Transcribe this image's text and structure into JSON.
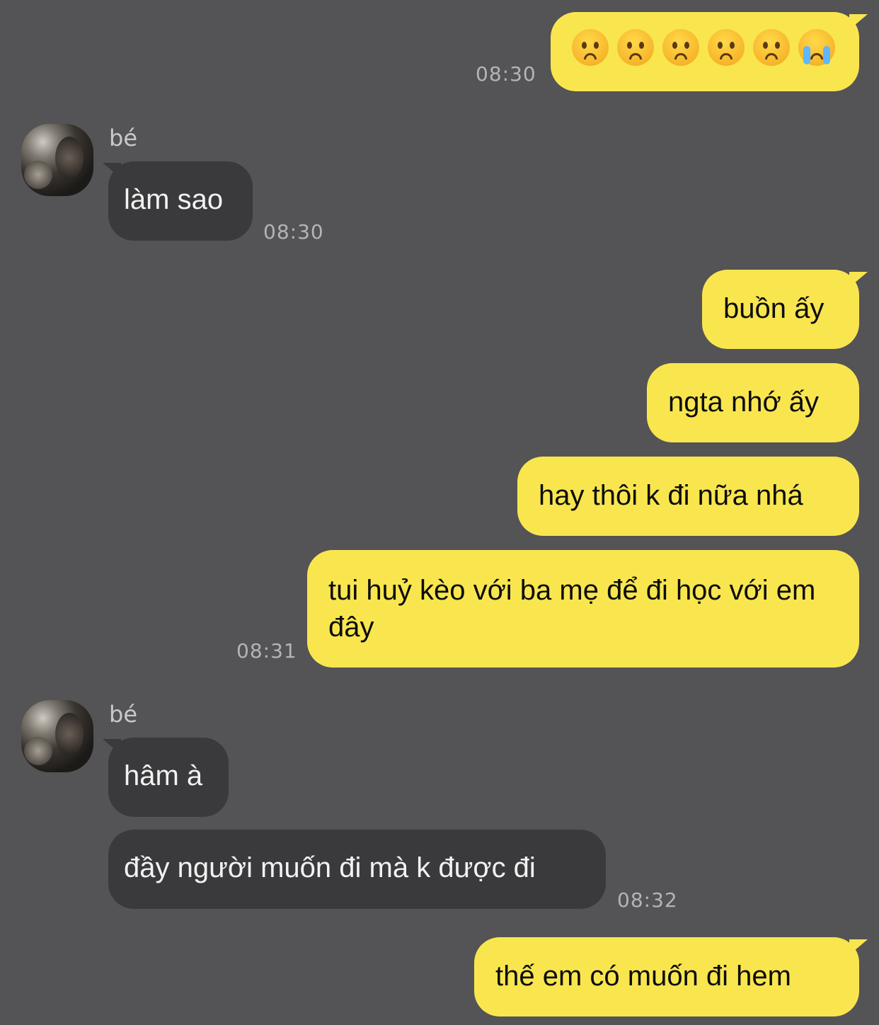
{
  "conversation": {
    "messages": [
      {
        "id": "m1",
        "direction": "outgoing",
        "text": "😟😩😣😟😔😭",
        "time": "08:30"
      },
      {
        "id": "m2",
        "direction": "incoming",
        "sender": "bé",
        "text": "làm sao",
        "time": "08:30"
      },
      {
        "id": "m3",
        "direction": "outgoing",
        "text": "buồn ấy"
      },
      {
        "id": "m4",
        "direction": "outgoing",
        "text": "ngta nhớ ấy"
      },
      {
        "id": "m5",
        "direction": "outgoing",
        "text": "hay thôi k đi nữa nhá"
      },
      {
        "id": "m6",
        "direction": "outgoing",
        "text": "tui huỷ kèo với ba mẹ để đi học với em đây",
        "time": "08:31"
      },
      {
        "id": "m7",
        "direction": "incoming",
        "sender": "bé",
        "text": "hâm à"
      },
      {
        "id": "m8",
        "direction": "incoming",
        "text": "đầy người muốn đi mà k được đi",
        "time": "08:32"
      },
      {
        "id": "m9",
        "direction": "outgoing",
        "text": "thế em có muốn đi hem"
      }
    ],
    "emoji_names": [
      "anxious-face-icon",
      "weary-face-icon",
      "persevering-face-icon",
      "worried-face-icon",
      "pensive-face-icon",
      "loudly-crying-face-icon"
    ]
  },
  "colors": {
    "background": "#545355",
    "outgoing_bubble": "#f9e64f",
    "incoming_bubble": "#3a393b",
    "timestamp": "#b4b3b6"
  }
}
